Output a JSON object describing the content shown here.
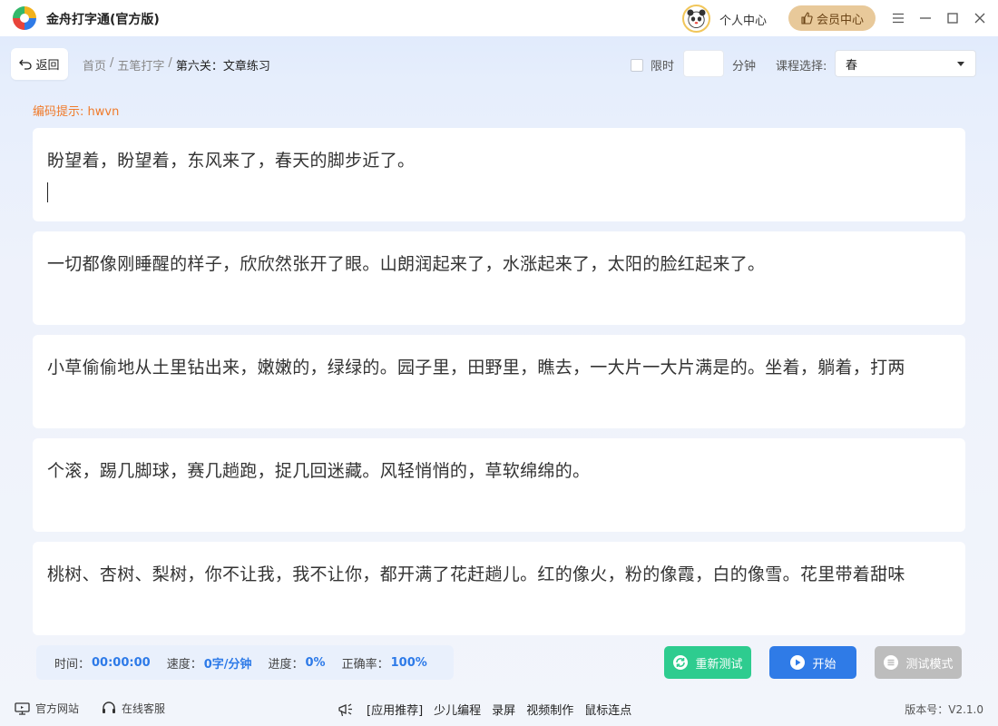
{
  "app": {
    "title": "金舟打字通(官方版)"
  },
  "header": {
    "personal_center": "个人中心",
    "vip_center": "会员中心"
  },
  "toolbar": {
    "back_label": "返回",
    "breadcrumb": {
      "home": "首页",
      "wubi": "五笔打字",
      "current": "第六关：文章练习",
      "separator": "/"
    },
    "time_limit_label": "限时",
    "minutes_value": "",
    "minutes_unit": "分钟",
    "course_label": "课程选择:",
    "course_selected": "春"
  },
  "hint": "编码提示: hwvn",
  "lines": [
    {
      "text": "盼望着，盼望着，东风来了，春天的脚步近了。",
      "input": ""
    },
    {
      "text": "一切都像刚睡醒的样子，欣欣然张开了眼。山朗润起来了，水涨起来了，太阳的脸红起来了。",
      "input": ""
    },
    {
      "text": "小草偷偷地从土里钻出来，嫩嫩的，绿绿的。园子里，田野里，瞧去，一大片一大片满是的。坐着，躺着，打两",
      "input": ""
    },
    {
      "text": "个滚，踢几脚球，赛几趟跑，捉几回迷藏。风轻悄悄的，草软绵绵的。",
      "input": ""
    },
    {
      "text": "桃树、杏树、梨树，你不让我，我不让你，都开满了花赶趟儿。红的像火，粉的像霞，白的像雪。花里带着甜味",
      "input": ""
    }
  ],
  "stats": {
    "time_label": "时间：",
    "time_value": "00:00:00",
    "speed_label": "速度：",
    "speed_value": "0字/分钟",
    "progress_label": "进度：",
    "progress_value": "0%",
    "accuracy_label": "正确率：",
    "accuracy_value": "100%"
  },
  "actions": {
    "retest": "重新测试",
    "start": "开始",
    "test_mode": "测试模式"
  },
  "footer": {
    "official_site": "官方网站",
    "online_service": "在线客服",
    "recommend": "[应用推荐]",
    "links": [
      "少儿编程",
      "录屏",
      "视频制作",
      "鼠标连点"
    ],
    "version": "版本号：V2.1.0"
  },
  "colors": {
    "accent": "#2f7be7",
    "retest": "#2ecc8f",
    "disabled": "#bdbdbd",
    "hint": "#f07a2a",
    "vip": "#e8c99a"
  }
}
